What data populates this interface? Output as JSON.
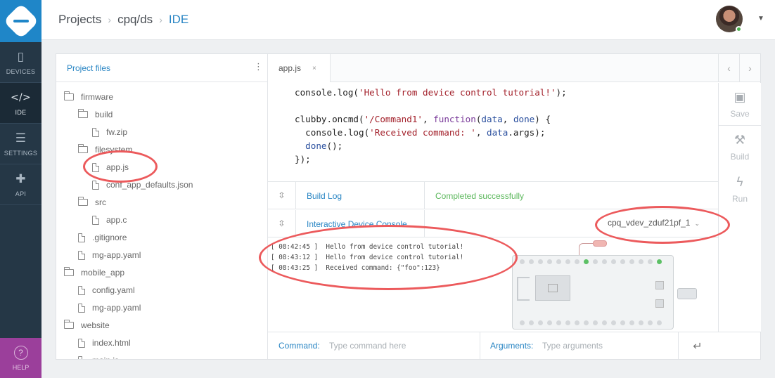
{
  "nav": {
    "items": [
      {
        "label": "DEVICES",
        "icon": "devices-icon",
        "glyph": "▯"
      },
      {
        "label": "IDE",
        "icon": "code-icon",
        "glyph": "</>"
      },
      {
        "label": "SETTINGS",
        "icon": "settings-sliders-icon",
        "glyph": "☰"
      },
      {
        "label": "API",
        "icon": "puzzle-icon",
        "glyph": "✚"
      }
    ],
    "help_label": "HELP",
    "help_glyph": "?"
  },
  "breadcrumb": {
    "items": [
      "Projects",
      "cpq/ds"
    ],
    "current": "IDE",
    "separator": "›"
  },
  "user": {
    "status_color": "#4caf50"
  },
  "files": {
    "title": "Project files",
    "menu_glyph": "⋮",
    "items": [
      {
        "name": "firmware",
        "type": "folder",
        "depth": 0
      },
      {
        "name": "build",
        "type": "folder",
        "depth": 1
      },
      {
        "name": "fw.zip",
        "type": "file",
        "depth": 2
      },
      {
        "name": "filesystem",
        "type": "folder",
        "depth": 1
      },
      {
        "name": "app.js",
        "type": "file",
        "depth": 2
      },
      {
        "name": "conf_app_defaults.json",
        "type": "file",
        "depth": 2
      },
      {
        "name": "src",
        "type": "folder",
        "depth": 1
      },
      {
        "name": "app.c",
        "type": "file",
        "depth": 2
      },
      {
        "name": ".gitignore",
        "type": "file",
        "depth": 1
      },
      {
        "name": "mg-app.yaml",
        "type": "file",
        "depth": 1
      },
      {
        "name": "mobile_app",
        "type": "folder",
        "depth": 0
      },
      {
        "name": "config.yaml",
        "type": "file",
        "depth": 1
      },
      {
        "name": "mg-app.yaml",
        "type": "file",
        "depth": 1
      },
      {
        "name": "website",
        "type": "folder",
        "depth": 0
      },
      {
        "name": "index.html",
        "type": "file",
        "depth": 1
      },
      {
        "name": "main.js",
        "type": "file",
        "depth": 1
      }
    ]
  },
  "tabs": {
    "open": [
      {
        "label": "app.js",
        "close": "×"
      }
    ],
    "prev_glyph": "‹",
    "next_glyph": "›"
  },
  "code": {
    "lines": [
      [
        {
          "t": "console.log(",
          "c": ""
        },
        {
          "t": "'Hello from device control tutorial!'",
          "c": "str"
        },
        {
          "t": ");",
          "c": ""
        }
      ],
      [],
      [
        {
          "t": "clubby.oncmd(",
          "c": ""
        },
        {
          "t": "'/Command1'",
          "c": "str"
        },
        {
          "t": ", ",
          "c": ""
        },
        {
          "t": "function",
          "c": "fn"
        },
        {
          "t": "(",
          "c": ""
        },
        {
          "t": "data",
          "c": "kw"
        },
        {
          "t": ", ",
          "c": ""
        },
        {
          "t": "done",
          "c": "kw"
        },
        {
          "t": ") {",
          "c": ""
        }
      ],
      [
        {
          "t": "  console.log(",
          "c": ""
        },
        {
          "t": "'Received command: '",
          "c": "str"
        },
        {
          "t": ", ",
          "c": ""
        },
        {
          "t": "data",
          "c": "kw"
        },
        {
          "t": ".args);",
          "c": ""
        }
      ],
      [
        {
          "t": "  ",
          "c": ""
        },
        {
          "t": "done",
          "c": "kw"
        },
        {
          "t": "();",
          "c": ""
        }
      ],
      [
        {
          "t": "});",
          "c": ""
        }
      ]
    ]
  },
  "actions": {
    "save": {
      "label": "Save",
      "glyph": "▣"
    },
    "build": {
      "label": "Build",
      "glyph": "⚒"
    },
    "run": {
      "label": "Run",
      "glyph": "ϟ"
    }
  },
  "build_log": {
    "title": "Build Log",
    "status": "Completed successfully",
    "toggle_glyph": "⇳",
    "status_color": "#5cb85c"
  },
  "console": {
    "title": "Interactive Device Console",
    "toggle_glyph": "⇳",
    "device": "cpq_vdev_zduf21pf_1",
    "device_caret": "⌄",
    "lines": [
      "[ 08:42:45 ]  Hello from device control tutorial!",
      "[ 08:43:12 ]  Hello from device control tutorial!",
      "[ 08:43:25 ]  Received command: {\"foo\":123}"
    ]
  },
  "command": {
    "label": "Command:",
    "placeholder": "Type command here",
    "args_label": "Arguments:",
    "args_placeholder": "Type arguments",
    "enter_glyph": "↵"
  },
  "colors": {
    "accent": "#2a86c4",
    "nav_bg": "#253746",
    "logo_bg": "#1f86c8",
    "help_bg": "#9b3f9b",
    "annotation": "#ec5a5c"
  }
}
